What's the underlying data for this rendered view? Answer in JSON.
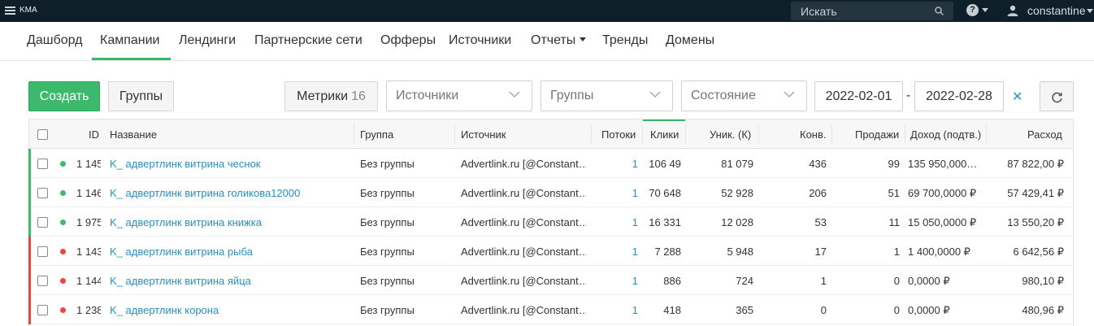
{
  "topbar": {
    "brand": "KMA",
    "search_placeholder": "Искать",
    "help_label": "?",
    "username": "constantine"
  },
  "nav": {
    "items": [
      {
        "label": "Дашборд"
      },
      {
        "label": "Кампании",
        "active": true
      },
      {
        "label": "Лендинги"
      },
      {
        "label": "Партнерские сети"
      },
      {
        "label": "Офферы"
      },
      {
        "label": "Источники"
      },
      {
        "label": "Отчеты"
      },
      {
        "label": "Тренды"
      },
      {
        "label": "Домены"
      }
    ]
  },
  "toolbar": {
    "create_label": "Создать",
    "groups_label": "Группы",
    "metrics_label": "Метрики",
    "metrics_count": "16",
    "sources_placeholder": "Источники",
    "groups_placeholder": "Группы",
    "state_placeholder": "Состояние",
    "date_from": "2022-02-01",
    "date_sep": "-",
    "date_to": "2022-02-28",
    "clear_label": "✕"
  },
  "table": {
    "columns": [
      "ID",
      "Название",
      "Группа",
      "Источник",
      "Потоки",
      "Клики",
      "Уник. (К)",
      "Конв.",
      "Продажи",
      "Доход (подтв.)",
      "Расход"
    ],
    "rows": [
      {
        "status": "active",
        "id": "1 145",
        "name": "K_ адвертлинк витрина чеснок",
        "group": "Без группы",
        "source": "Advertlink.ru [@Constant…",
        "flows": "1",
        "clicks": "106 49",
        "uniq": "81 079",
        "conv": "436",
        "sales": "99",
        "income": "135 950,000…",
        "expense": "87 822,00 ₽"
      },
      {
        "status": "active",
        "id": "1 146",
        "name": "K_ адвертлинк витрина голикова12000",
        "group": "Без группы",
        "source": "Advertlink.ru [@Constant…",
        "flows": "1",
        "clicks": "70 648",
        "uniq": "52 928",
        "conv": "206",
        "sales": "51",
        "income": "69 700,0000 ₽",
        "expense": "57 429,41 ₽"
      },
      {
        "status": "active",
        "id": "1 975",
        "name": "K_ адвертлинк витрина книжка",
        "group": "Без группы",
        "source": "Advertlink.ru [@Constant…",
        "flows": "1",
        "clicks": "16 331",
        "uniq": "12 028",
        "conv": "53",
        "sales": "11",
        "income": "15 050,0000 ₽",
        "expense": "13 550,20 ₽"
      },
      {
        "status": "stopped",
        "id": "1 143",
        "name": "K_ адвертлинк витрина рыба",
        "group": "Без группы",
        "source": "Advertlink.ru [@Constant…",
        "flows": "1",
        "clicks": "7 288",
        "uniq": "5 948",
        "conv": "17",
        "sales": "1",
        "income": "1 400,0000 ₽",
        "expense": "6 642,56 ₽"
      },
      {
        "status": "stopped",
        "id": "1 144",
        "name": "K_ адвертлинк витрина яйца",
        "group": "Без группы",
        "source": "Advertlink.ru [@Constant…",
        "flows": "1",
        "clicks": "886",
        "uniq": "724",
        "conv": "1",
        "sales": "0",
        "income": "0,0000 ₽",
        "expense": "980,10 ₽"
      },
      {
        "status": "stopped",
        "id": "1 238",
        "name": "K_ адвертлинк корона",
        "group": "Без группы",
        "source": "Advertlink.ru [@Constant…",
        "flows": "1",
        "clicks": "418",
        "uniq": "365",
        "conv": "0",
        "sales": "0",
        "income": "0,0000 ₽",
        "expense": "480,96 ₽"
      }
    ]
  },
  "colors": {
    "active": "#3fb96a",
    "stopped": "#e5483c",
    "link": "#2a8fc0",
    "primary": "#3cb96a"
  }
}
